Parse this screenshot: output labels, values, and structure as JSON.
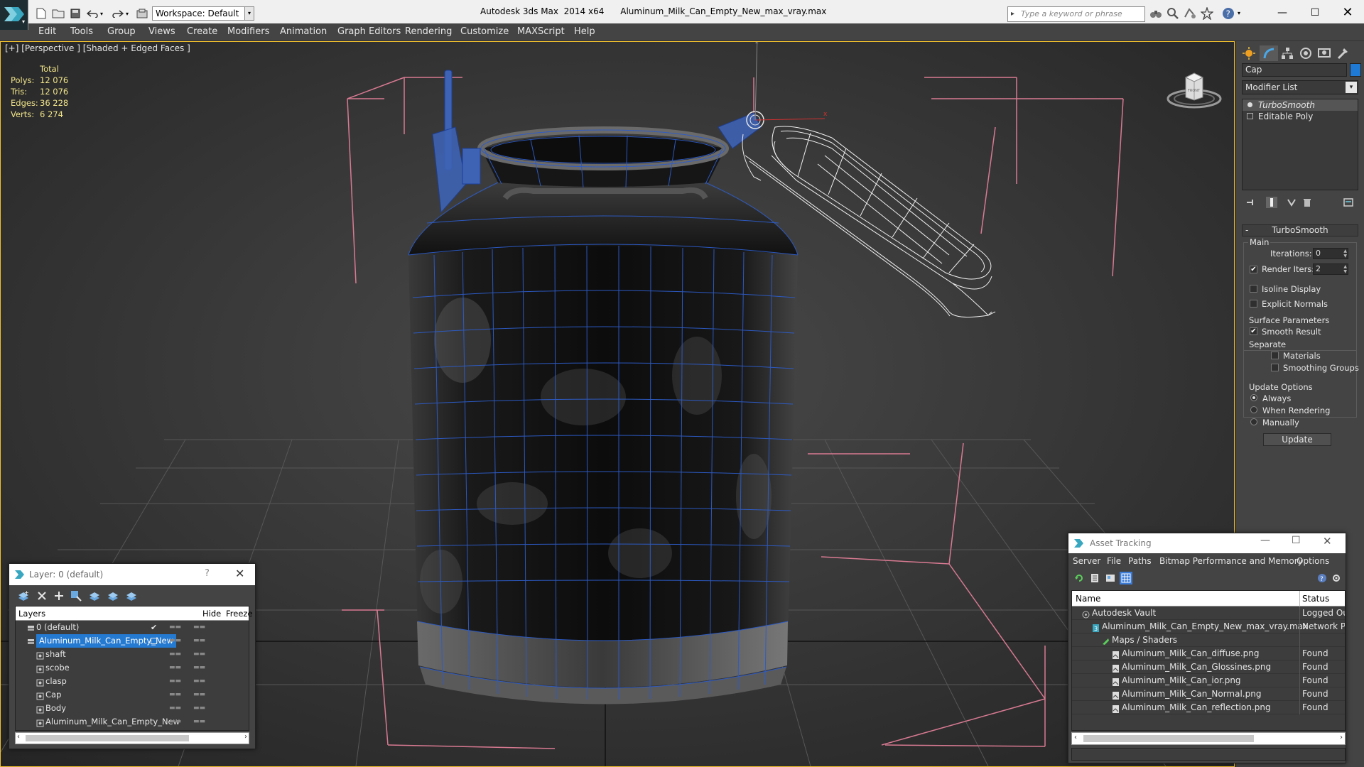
{
  "titlebar": {
    "workspace": "Workspace: Default",
    "app": "Autodesk 3ds Max  2014 x64",
    "file": "Aluminum_Milk_Can_Empty_New_max_vray.max",
    "search_placeholder": "Type a keyword or phrase"
  },
  "menu": [
    "Edit",
    "Tools",
    "Group",
    "Views",
    "Create",
    "Modifiers",
    "Animation",
    "Graph Editors",
    "Rendering",
    "Customize",
    "MAXScript",
    "Help"
  ],
  "viewport": {
    "label": "[+] [Perspective ] [Shaded + Edged Faces ]",
    "stats": {
      "header": "Total",
      "rows": [
        {
          "label": "Polys:",
          "value": "12 076"
        },
        {
          "label": "Tris:",
          "value": "12 076"
        },
        {
          "label": "Edges:",
          "value": "36 228"
        },
        {
          "label": "Verts:",
          "value": "6 274"
        }
      ]
    },
    "viewcube_label": "FRONT"
  },
  "command_panel": {
    "object_name": "Cap",
    "object_color": "#1f7ad6",
    "modifier_list": "Modifier List",
    "stack": [
      {
        "label": "TurboSmooth",
        "active": true
      },
      {
        "label": "Editable Poly",
        "active": false
      }
    ],
    "rollout_title": "TurboSmooth",
    "main_group": "Main",
    "iterations_label": "Iterations:",
    "iterations_value": "0",
    "render_iters_label": "Render Iters:",
    "render_iters_value": "2",
    "render_iters_checked": true,
    "isoline_label": "Isoline Display",
    "explicit_normals_label": "Explicit Normals",
    "surface_group": "Surface Parameters",
    "smooth_result_label": "Smooth Result",
    "separate_label": "Separate",
    "materials_label": "Materials",
    "smoothing_groups_label": "Smoothing Groups",
    "update_group": "Update Options",
    "always_label": "Always",
    "when_rendering_label": "When Rendering",
    "manually_label": "Manually",
    "update_button": "Update"
  },
  "layer_panel": {
    "title": "Layer: 0 (default)",
    "help": "?",
    "columns": {
      "layers": "Layers",
      "hide": "Hide",
      "freeze": "Freeze"
    },
    "rows": [
      {
        "name": "0 (default)",
        "level": 0,
        "selected": false,
        "checked": true
      },
      {
        "name": "Aluminum_Milk_Can_Empty_New",
        "level": 0,
        "selected": true,
        "checked": false
      },
      {
        "name": "shaft",
        "level": 1,
        "selected": false,
        "checked": false
      },
      {
        "name": "scobe",
        "level": 1,
        "selected": false,
        "checked": false
      },
      {
        "name": "clasp",
        "level": 1,
        "selected": false,
        "checked": false
      },
      {
        "name": "Cap",
        "level": 1,
        "selected": false,
        "checked": false
      },
      {
        "name": "Body",
        "level": 1,
        "selected": false,
        "checked": false
      },
      {
        "name": "Aluminum_Milk_Can_Empty_New",
        "level": 1,
        "selected": false,
        "checked": false
      }
    ]
  },
  "asset_panel": {
    "title": "Asset Tracking",
    "menu": [
      "Server",
      "File",
      "Paths",
      "Bitmap Performance and Memory",
      "Options"
    ],
    "columns": {
      "name": "Name",
      "status": "Status"
    },
    "rows": [
      {
        "name": "Autodesk Vault",
        "status": "Logged Ou",
        "level": 0
      },
      {
        "name": "Aluminum_Milk_Can_Empty_New_max_vray.max",
        "status": "Network Pa",
        "level": 1
      },
      {
        "name": "Maps / Shaders",
        "status": "",
        "level": 2
      },
      {
        "name": "Aluminum_Milk_Can_diffuse.png",
        "status": "Found",
        "level": 3
      },
      {
        "name": "Aluminum_Milk_Can_Glossines.png",
        "status": "Found",
        "level": 3
      },
      {
        "name": "Aluminum_Milk_Can_ior.png",
        "status": "Found",
        "level": 3
      },
      {
        "name": "Aluminum_Milk_Can_Normal.png",
        "status": "Found",
        "level": 3
      },
      {
        "name": "Aluminum_Milk_Can_reflection.png",
        "status": "Found",
        "level": 3
      }
    ]
  }
}
